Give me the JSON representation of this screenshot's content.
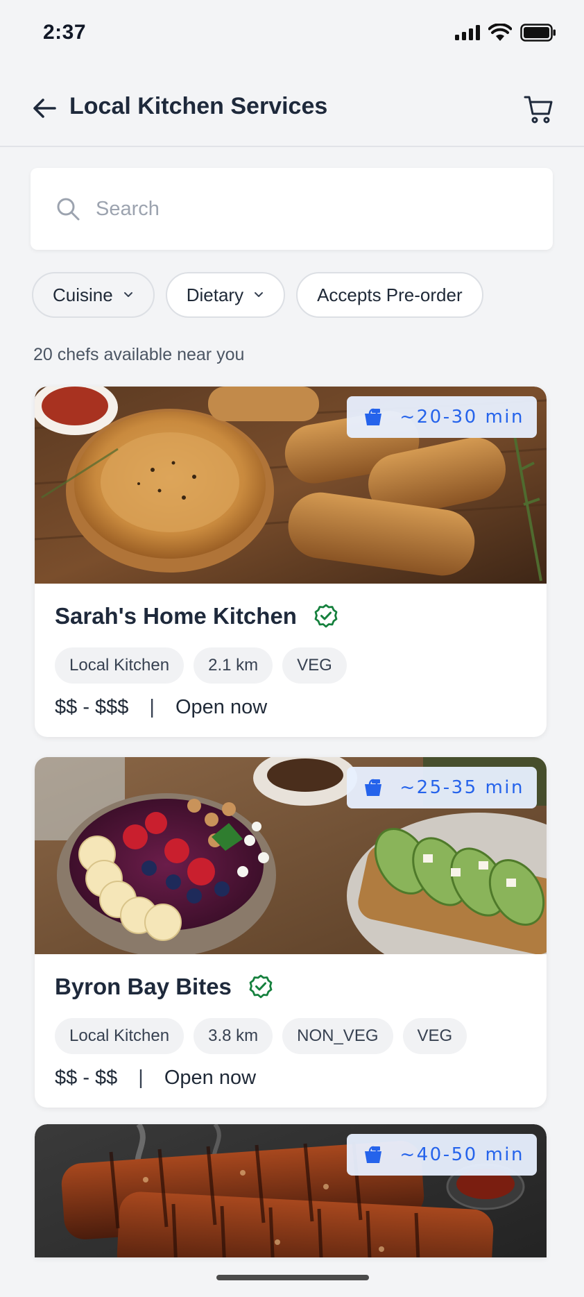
{
  "status_bar": {
    "time": "2:37"
  },
  "header": {
    "title": "Local Kitchen Services",
    "back_icon": "arrow-left-icon",
    "cart_icon": "cart-icon"
  },
  "search": {
    "placeholder": "Search",
    "value": ""
  },
  "filters": [
    {
      "label": "Cuisine",
      "type": "dropdown"
    },
    {
      "label": "Dietary",
      "type": "dropdown"
    },
    {
      "label": "Accepts Pre-order",
      "type": "toggle"
    }
  ],
  "results": {
    "count_text": "20 chefs available near you"
  },
  "colors": {
    "accent": "#2563eb",
    "verified": "#15803d",
    "background": "#f3f4f6"
  },
  "chefs": [
    {
      "name": "Sarah's Home Kitchen",
      "verified": true,
      "eta": "~20-30 min",
      "tags": [
        "Local Kitchen",
        "2.1 km",
        "VEG"
      ],
      "price": "$$ - $$$",
      "status": "Open now",
      "image": "pies-and-sausage-rolls"
    },
    {
      "name": "Byron Bay Bites",
      "verified": true,
      "eta": "~25-35 min",
      "tags": [
        "Local Kitchen",
        "3.8 km",
        "NON_VEG",
        "VEG"
      ],
      "price": "$$ - $$",
      "status": "Open now",
      "image": "acai-bowl-and-avocado-toast"
    },
    {
      "name": "",
      "verified": false,
      "eta": "~40-50 min",
      "tags": [],
      "price": "",
      "status": "",
      "image": "grilled-ribs"
    }
  ]
}
